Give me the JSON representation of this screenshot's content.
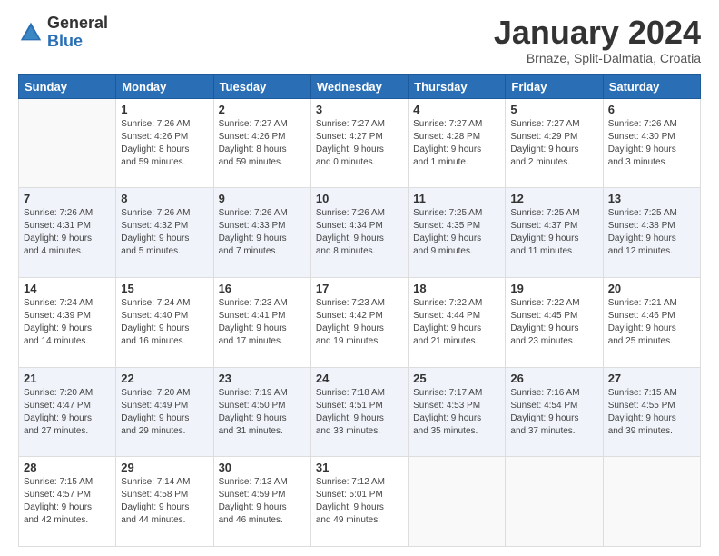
{
  "header": {
    "logo_general": "General",
    "logo_blue": "Blue",
    "month_title": "January 2024",
    "subtitle": "Brnaze, Split-Dalmatia, Croatia"
  },
  "weekdays": [
    "Sunday",
    "Monday",
    "Tuesday",
    "Wednesday",
    "Thursday",
    "Friday",
    "Saturday"
  ],
  "weeks": [
    [
      {
        "day": "",
        "info": ""
      },
      {
        "day": "1",
        "info": "Sunrise: 7:26 AM\nSunset: 4:26 PM\nDaylight: 8 hours\nand 59 minutes."
      },
      {
        "day": "2",
        "info": "Sunrise: 7:27 AM\nSunset: 4:26 PM\nDaylight: 8 hours\nand 59 minutes."
      },
      {
        "day": "3",
        "info": "Sunrise: 7:27 AM\nSunset: 4:27 PM\nDaylight: 9 hours\nand 0 minutes."
      },
      {
        "day": "4",
        "info": "Sunrise: 7:27 AM\nSunset: 4:28 PM\nDaylight: 9 hours\nand 1 minute."
      },
      {
        "day": "5",
        "info": "Sunrise: 7:27 AM\nSunset: 4:29 PM\nDaylight: 9 hours\nand 2 minutes."
      },
      {
        "day": "6",
        "info": "Sunrise: 7:26 AM\nSunset: 4:30 PM\nDaylight: 9 hours\nand 3 minutes."
      }
    ],
    [
      {
        "day": "7",
        "info": "Sunrise: 7:26 AM\nSunset: 4:31 PM\nDaylight: 9 hours\nand 4 minutes."
      },
      {
        "day": "8",
        "info": "Sunrise: 7:26 AM\nSunset: 4:32 PM\nDaylight: 9 hours\nand 5 minutes."
      },
      {
        "day": "9",
        "info": "Sunrise: 7:26 AM\nSunset: 4:33 PM\nDaylight: 9 hours\nand 7 minutes."
      },
      {
        "day": "10",
        "info": "Sunrise: 7:26 AM\nSunset: 4:34 PM\nDaylight: 9 hours\nand 8 minutes."
      },
      {
        "day": "11",
        "info": "Sunrise: 7:25 AM\nSunset: 4:35 PM\nDaylight: 9 hours\nand 9 minutes."
      },
      {
        "day": "12",
        "info": "Sunrise: 7:25 AM\nSunset: 4:37 PM\nDaylight: 9 hours\nand 11 minutes."
      },
      {
        "day": "13",
        "info": "Sunrise: 7:25 AM\nSunset: 4:38 PM\nDaylight: 9 hours\nand 12 minutes."
      }
    ],
    [
      {
        "day": "14",
        "info": "Sunrise: 7:24 AM\nSunset: 4:39 PM\nDaylight: 9 hours\nand 14 minutes."
      },
      {
        "day": "15",
        "info": "Sunrise: 7:24 AM\nSunset: 4:40 PM\nDaylight: 9 hours\nand 16 minutes."
      },
      {
        "day": "16",
        "info": "Sunrise: 7:23 AM\nSunset: 4:41 PM\nDaylight: 9 hours\nand 17 minutes."
      },
      {
        "day": "17",
        "info": "Sunrise: 7:23 AM\nSunset: 4:42 PM\nDaylight: 9 hours\nand 19 minutes."
      },
      {
        "day": "18",
        "info": "Sunrise: 7:22 AM\nSunset: 4:44 PM\nDaylight: 9 hours\nand 21 minutes."
      },
      {
        "day": "19",
        "info": "Sunrise: 7:22 AM\nSunset: 4:45 PM\nDaylight: 9 hours\nand 23 minutes."
      },
      {
        "day": "20",
        "info": "Sunrise: 7:21 AM\nSunset: 4:46 PM\nDaylight: 9 hours\nand 25 minutes."
      }
    ],
    [
      {
        "day": "21",
        "info": "Sunrise: 7:20 AM\nSunset: 4:47 PM\nDaylight: 9 hours\nand 27 minutes."
      },
      {
        "day": "22",
        "info": "Sunrise: 7:20 AM\nSunset: 4:49 PM\nDaylight: 9 hours\nand 29 minutes."
      },
      {
        "day": "23",
        "info": "Sunrise: 7:19 AM\nSunset: 4:50 PM\nDaylight: 9 hours\nand 31 minutes."
      },
      {
        "day": "24",
        "info": "Sunrise: 7:18 AM\nSunset: 4:51 PM\nDaylight: 9 hours\nand 33 minutes."
      },
      {
        "day": "25",
        "info": "Sunrise: 7:17 AM\nSunset: 4:53 PM\nDaylight: 9 hours\nand 35 minutes."
      },
      {
        "day": "26",
        "info": "Sunrise: 7:16 AM\nSunset: 4:54 PM\nDaylight: 9 hours\nand 37 minutes."
      },
      {
        "day": "27",
        "info": "Sunrise: 7:15 AM\nSunset: 4:55 PM\nDaylight: 9 hours\nand 39 minutes."
      }
    ],
    [
      {
        "day": "28",
        "info": "Sunrise: 7:15 AM\nSunset: 4:57 PM\nDaylight: 9 hours\nand 42 minutes."
      },
      {
        "day": "29",
        "info": "Sunrise: 7:14 AM\nSunset: 4:58 PM\nDaylight: 9 hours\nand 44 minutes."
      },
      {
        "day": "30",
        "info": "Sunrise: 7:13 AM\nSunset: 4:59 PM\nDaylight: 9 hours\nand 46 minutes."
      },
      {
        "day": "31",
        "info": "Sunrise: 7:12 AM\nSunset: 5:01 PM\nDaylight: 9 hours\nand 49 minutes."
      },
      {
        "day": "",
        "info": ""
      },
      {
        "day": "",
        "info": ""
      },
      {
        "day": "",
        "info": ""
      }
    ]
  ]
}
